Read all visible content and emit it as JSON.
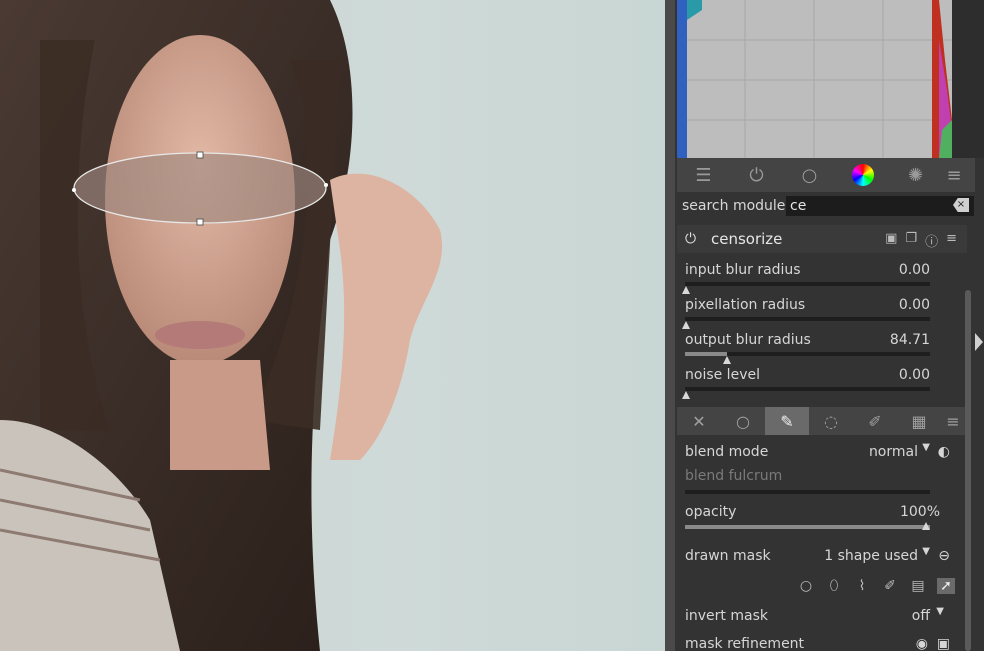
{
  "histogram": {
    "label": "histogram"
  },
  "module_tabs": [
    "sliders-icon",
    "power-icon",
    "circle-icon",
    "color-wheel-icon",
    "effects-icon",
    "menu-icon"
  ],
  "search": {
    "label": "search module",
    "value": "ce"
  },
  "module": {
    "title": "censorize"
  },
  "sliders": [
    {
      "label": "input blur radius",
      "value": "0.00",
      "fraction": 0
    },
    {
      "label": "pixellation radius",
      "value": "0.00",
      "fraction": 0
    },
    {
      "label": "output blur radius",
      "value": "84.71",
      "fraction": 0.17
    },
    {
      "label": "noise level",
      "value": "0.00",
      "fraction": 0
    }
  ],
  "blend": {
    "mode_label": "blend mode",
    "mode_value": "normal",
    "fulcrum_label": "blend fulcrum",
    "opacity_label": "opacity",
    "opacity_value": "100%",
    "opacity_fraction": 1.0,
    "drawn_mask_label": "drawn mask",
    "drawn_mask_value": "1 shape used",
    "invert_label": "invert mask",
    "invert_value": "off",
    "refinement_label": "mask refinement"
  }
}
